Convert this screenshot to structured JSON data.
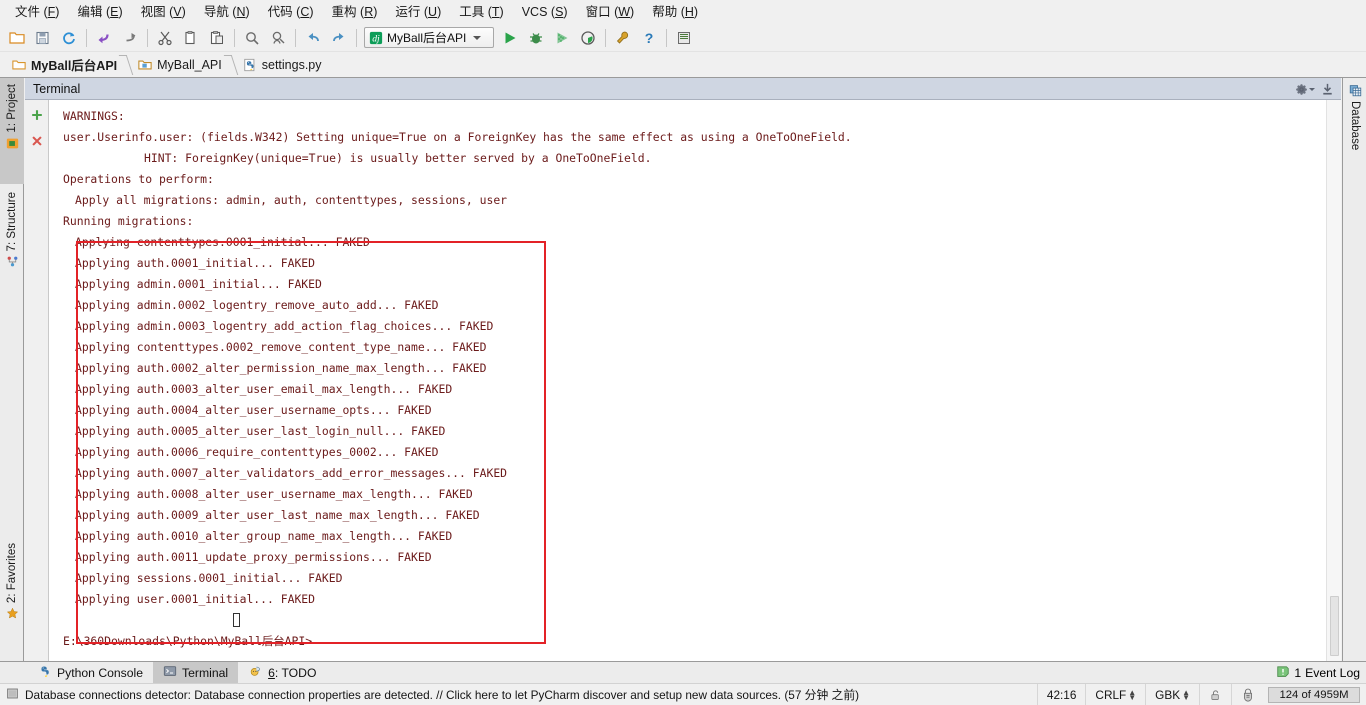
{
  "menu": {
    "items": [
      {
        "label": "文件",
        "mnemonic": "F"
      },
      {
        "label": "编辑",
        "mnemonic": "E"
      },
      {
        "label": "视图",
        "mnemonic": "V"
      },
      {
        "label": "导航",
        "mnemonic": "N"
      },
      {
        "label": "代码",
        "mnemonic": "C"
      },
      {
        "label": "重构",
        "mnemonic": "R"
      },
      {
        "label": "运行",
        "mnemonic": "U"
      },
      {
        "label": "工具",
        "mnemonic": "T"
      },
      {
        "label": "VCS",
        "mnemonic": "S"
      },
      {
        "label": "窗口",
        "mnemonic": "W"
      },
      {
        "label": "帮助",
        "mnemonic": "H"
      }
    ]
  },
  "toolbar": {
    "icons": [
      "open-folder-icon",
      "save-all-icon",
      "sync-icon",
      "back-icon",
      "forward-icon",
      "cut-icon",
      "copy-icon",
      "paste-icon",
      "find-icon",
      "replace-icon",
      "undo-icon",
      "redo-icon"
    ],
    "run_config": {
      "name": "MyBall后台API",
      "icon": "django-icon"
    },
    "run_icons": [
      "run-icon",
      "debug-icon",
      "coverage-icon",
      "profile-icon",
      "settings-wrench-icon",
      "help-icon",
      "database-save-icon"
    ]
  },
  "breadcrumb": {
    "items": [
      {
        "label": "MyBall后台API",
        "icon": "folder-orange-icon"
      },
      {
        "label": "MyBall_API",
        "icon": "folder-blue-icon"
      },
      {
        "label": "settings.py",
        "icon": "python-file-icon"
      }
    ]
  },
  "left_stripe": {
    "tabs": [
      {
        "label": "1: Project",
        "icon": "project-icon",
        "selected": true
      },
      {
        "label": "7: Structure",
        "icon": "structure-icon",
        "selected": false
      },
      {
        "label": "2: Favorites",
        "icon": "star-icon",
        "selected": false
      }
    ]
  },
  "right_stripe": {
    "tabs": [
      {
        "label": "Database",
        "icon": "database-icon",
        "selected": false
      }
    ]
  },
  "tool_window": {
    "title": "Terminal",
    "actions": [
      "gear-icon",
      "hide-icon"
    ],
    "gutter_buttons": [
      "new-session-plus-icon",
      "close-session-x-icon"
    ]
  },
  "terminal": {
    "lines": [
      {
        "text": "WARNINGS:",
        "indent": 0
      },
      {
        "text": "user.Userinfo.user: (fields.W342) Setting unique=True on a ForeignKey has the same effect as using a OneToOneField.",
        "indent": 0
      },
      {
        "text": "HINT: ForeignKey(unique=True) is usually better served by a OneToOneField.",
        "indent": 2
      },
      {
        "text": "Operations to perform:",
        "indent": 0
      },
      {
        "text": "Apply all migrations: admin, auth, contenttypes, sessions, user",
        "indent": 1
      },
      {
        "text": "Running migrations:",
        "indent": 0
      },
      {
        "text": "Applying contenttypes.0001_initial... FAKED",
        "indent": 1
      },
      {
        "text": "Applying auth.0001_initial... FAKED",
        "indent": 1
      },
      {
        "text": "Applying admin.0001_initial... FAKED",
        "indent": 1
      },
      {
        "text": "Applying admin.0002_logentry_remove_auto_add... FAKED",
        "indent": 1
      },
      {
        "text": "Applying admin.0003_logentry_add_action_flag_choices... FAKED",
        "indent": 1
      },
      {
        "text": "Applying contenttypes.0002_remove_content_type_name... FAKED",
        "indent": 1
      },
      {
        "text": "Applying auth.0002_alter_permission_name_max_length... FAKED",
        "indent": 1
      },
      {
        "text": "Applying auth.0003_alter_user_email_max_length... FAKED",
        "indent": 1
      },
      {
        "text": "Applying auth.0004_alter_user_username_opts... FAKED",
        "indent": 1
      },
      {
        "text": "Applying auth.0005_alter_user_last_login_null... FAKED",
        "indent": 1
      },
      {
        "text": "Applying auth.0006_require_contenttypes_0002... FAKED",
        "indent": 1
      },
      {
        "text": "Applying auth.0007_alter_validators_add_error_messages... FAKED",
        "indent": 1
      },
      {
        "text": "Applying auth.0008_alter_user_username_max_length... FAKED",
        "indent": 1
      },
      {
        "text": "Applying auth.0009_alter_user_last_name_max_length... FAKED",
        "indent": 1
      },
      {
        "text": "Applying auth.0010_alter_group_name_max_length... FAKED",
        "indent": 1
      },
      {
        "text": "Applying auth.0011_update_proxy_permissions... FAKED",
        "indent": 1
      },
      {
        "text": "Applying sessions.0001_initial... FAKED",
        "indent": 1
      },
      {
        "text": "Applying user.0001_initial... FAKED",
        "indent": 1
      }
    ],
    "prompt": "E:\\360Downloads\\Python\\MyBall后台API>",
    "text_color": "#6b1a1a",
    "background": "#ffffff"
  },
  "annotation": {
    "color": "#e32227",
    "shape": "rectangle"
  },
  "bottom_bar": {
    "tabs": [
      {
        "label": "Python Console",
        "icon": "python-console-icon",
        "selected": false
      },
      {
        "label": "Terminal",
        "icon": "terminal-icon",
        "selected": true
      },
      {
        "label": "6: TODO",
        "icon": "todo-icon",
        "selected": false
      }
    ],
    "event_log": {
      "count": "1",
      "label": "Event Log",
      "icon": "event-log-icon"
    }
  },
  "status_bar": {
    "message": "Database connections detector: Database connection properties are detected. // Click here to let PyCharm discover and setup new data sources. (57 分钟 之前)",
    "message_icon": "notification-icon",
    "caret_position": "42:16",
    "line_separator": "CRLF",
    "encoding": "GBK",
    "lock_icon": "unlocked-icon",
    "inspection_icon": "hector-icon",
    "memory": "124 of 4959M"
  }
}
